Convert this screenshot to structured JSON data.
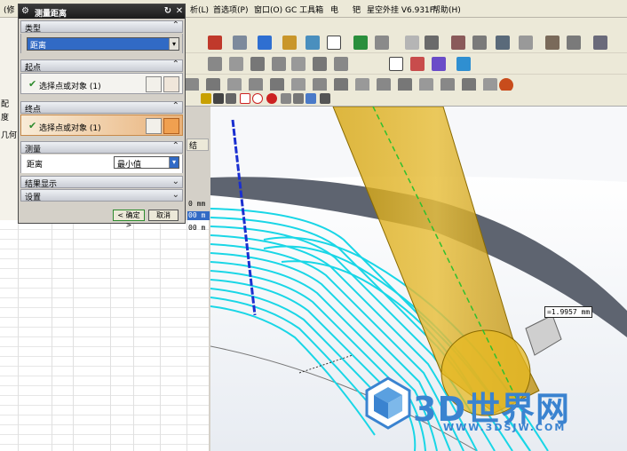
{
  "menubar": {
    "items": [
      {
        "label": "析(L)"
      },
      {
        "label": "首选项(P)"
      },
      {
        "label": "窗口(O)"
      },
      {
        "label": "GC 工具箱"
      },
      {
        "label": "电"
      },
      {
        "label": "钯"
      },
      {
        "label": "星空外挂 V6.931F"
      },
      {
        "label": "帮助(H)"
      }
    ],
    "left_fragment": "(修"
  },
  "left_panel": {
    "labels": [
      "配",
      "度",
      "几何"
    ],
    "table_header": "结",
    "table_cells": [
      "0 mm",
      "00 m",
      "00 m"
    ]
  },
  "dialog": {
    "title": "测量距离",
    "sections": {
      "type": {
        "label": "类型",
        "value": "距离"
      },
      "start": {
        "label": "起点",
        "pick_label": "选择点或对象",
        "count": "(1)"
      },
      "end": {
        "label": "终点",
        "pick_label": "选择点或对象",
        "count": "(1)"
      },
      "measure": {
        "label": "测量",
        "field_label": "距离",
        "field_value": "最小值"
      },
      "results": {
        "label": "结果显示"
      },
      "settings": {
        "label": "设置"
      }
    },
    "ok_label": "< 确定 >",
    "cancel_label": "取消"
  },
  "viewport": {
    "measure_readout": "=1.9957 mm",
    "watermark_main": "3D世界网",
    "watermark_url": "WWW.3DSJW.COM"
  },
  "colors": {
    "toolpath": "#19d6e6",
    "solid": "#d9a200",
    "axis": "#1a2fd0",
    "dash": "#2ec02e"
  }
}
